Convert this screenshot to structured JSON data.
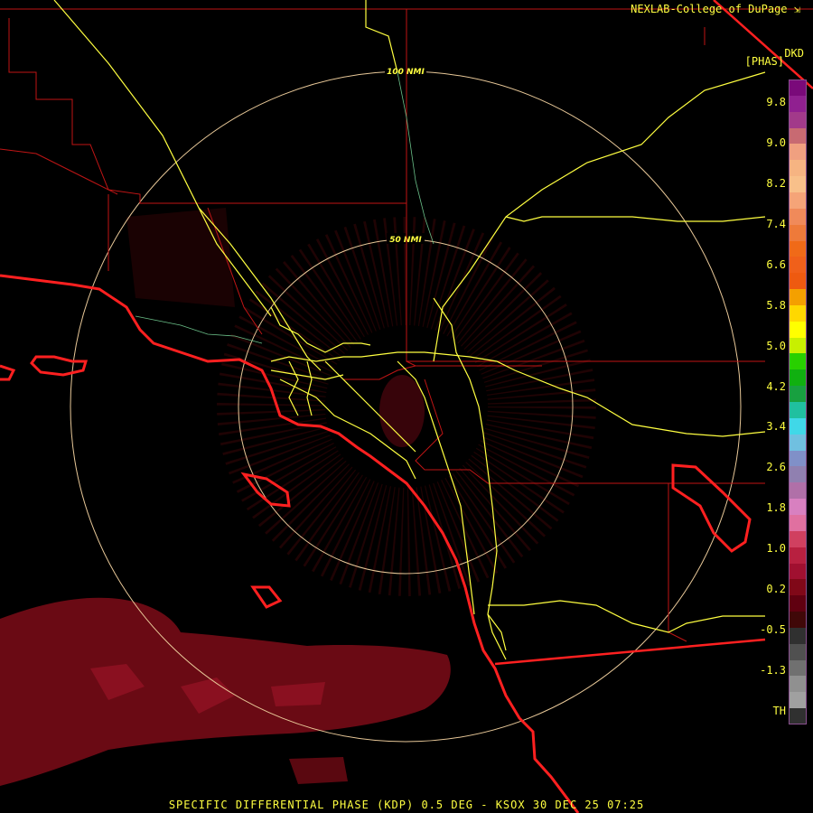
{
  "header": {
    "credit": "NEXLAB-College of DuPage",
    "credit_icon": "external-link-icon"
  },
  "product": {
    "code": "DKD",
    "unit": "[PHAS]"
  },
  "footer": {
    "text": "SPECIFIC DIFFERENTIAL PHASE (KDP) 0.5 DEG - KSOX 30 DEC 25 07:25"
  },
  "range_rings": [
    {
      "label": "50 NMI"
    },
    {
      "label": "100 NMI"
    }
  ],
  "legend": {
    "labels": [
      "9.8",
      "9.0",
      "8.2",
      "7.4",
      "6.6",
      "5.8",
      "5.0",
      "4.2",
      "3.4",
      "2.6",
      "1.8",
      "1.0",
      "0.2",
      "-0.5",
      "-1.3",
      "TH"
    ],
    "colors": [
      "#7a0a7a",
      "#902090",
      "#a23a8a",
      "#c86a72",
      "#f0a080",
      "#f6b482",
      "#f8c08a",
      "#f5a478",
      "#f08a5a",
      "#ee7a3a",
      "#f06a18",
      "#f0601a",
      "#ee5a10",
      "#f4a000",
      "#ffd800",
      "#ffff00",
      "#c8f000",
      "#28d000",
      "#10b010",
      "#18a040",
      "#20c0a0",
      "#40d8e8",
      "#70c0e0",
      "#8090c8",
      "#9080b0",
      "#b070a8",
      "#d880c0",
      "#e070a0",
      "#d04060",
      "#b82040",
      "#a01030",
      "#800818",
      "#600010",
      "#400808",
      "#303030",
      "#505050",
      "#707070",
      "#909090",
      "#a0a0a0",
      "#303030"
    ]
  },
  "colors": {
    "background": "#000000",
    "coast": "#ff2020",
    "roads": "#ffff40",
    "borders": "#d01818",
    "rings": "#e8c898",
    "echo": "#6a0a14"
  }
}
